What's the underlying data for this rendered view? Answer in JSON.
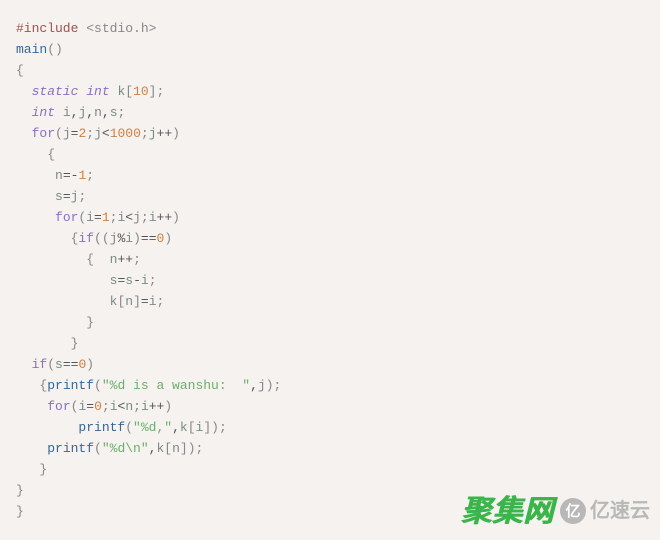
{
  "code": {
    "lines": [
      [
        {
          "t": "#include ",
          "c": "c-preproc"
        },
        {
          "t": "<",
          "c": "c-include-path"
        },
        {
          "t": "stdio",
          "c": "c-include-path"
        },
        {
          "t": ".",
          "c": "c-include-path"
        },
        {
          "t": "h",
          "c": "c-include-path"
        },
        {
          "t": ">",
          "c": "c-include-path"
        }
      ],
      [
        {
          "t": "main",
          "c": "c-builtin"
        },
        {
          "t": "(",
          "c": "c-paren"
        },
        {
          "t": ")",
          "c": "c-paren"
        }
      ],
      [
        {
          "t": "{",
          "c": "c-brace"
        }
      ],
      [
        {
          "t": "  ",
          "c": ""
        },
        {
          "t": "static int",
          "c": "c-keyword"
        },
        {
          "t": " ",
          "c": ""
        },
        {
          "t": "k",
          "c": "c-ident"
        },
        {
          "t": "[",
          "c": "c-bracket"
        },
        {
          "t": "10",
          "c": "c-num"
        },
        {
          "t": "]",
          "c": "c-bracket"
        },
        {
          "t": ";",
          "c": "c-semi"
        }
      ],
      [
        {
          "t": "  ",
          "c": ""
        },
        {
          "t": "int",
          "c": "c-keyword"
        },
        {
          "t": " ",
          "c": ""
        },
        {
          "t": "i",
          "c": "c-ident"
        },
        {
          "t": ",",
          "c": "c-op"
        },
        {
          "t": "j",
          "c": "c-ident"
        },
        {
          "t": ",",
          "c": "c-op"
        },
        {
          "t": "n",
          "c": "c-ident"
        },
        {
          "t": ",",
          "c": "c-op"
        },
        {
          "t": "s",
          "c": "c-ident"
        },
        {
          "t": ";",
          "c": "c-semi"
        }
      ],
      [
        {
          "t": "  ",
          "c": ""
        },
        {
          "t": "for",
          "c": "c-ctrl"
        },
        {
          "t": "(",
          "c": "c-paren"
        },
        {
          "t": "j",
          "c": "c-ident"
        },
        {
          "t": "=",
          "c": "c-op"
        },
        {
          "t": "2",
          "c": "c-num"
        },
        {
          "t": ";",
          "c": "c-semi"
        },
        {
          "t": "j",
          "c": "c-ident"
        },
        {
          "t": "<",
          "c": "c-op"
        },
        {
          "t": "1000",
          "c": "c-num"
        },
        {
          "t": ";",
          "c": "c-semi"
        },
        {
          "t": "j",
          "c": "c-ident"
        },
        {
          "t": "++",
          "c": "c-op"
        },
        {
          "t": ")",
          "c": "c-paren"
        }
      ],
      [
        {
          "t": "    ",
          "c": ""
        },
        {
          "t": "{",
          "c": "c-brace"
        }
      ],
      [
        {
          "t": "     ",
          "c": ""
        },
        {
          "t": "n",
          "c": "c-ident"
        },
        {
          "t": "=",
          "c": "c-op"
        },
        {
          "t": "-",
          "c": "c-op"
        },
        {
          "t": "1",
          "c": "c-num"
        },
        {
          "t": ";",
          "c": "c-semi"
        }
      ],
      [
        {
          "t": "     ",
          "c": ""
        },
        {
          "t": "s",
          "c": "c-ident"
        },
        {
          "t": "=",
          "c": "c-op"
        },
        {
          "t": "j",
          "c": "c-ident"
        },
        {
          "t": ";",
          "c": "c-semi"
        }
      ],
      [
        {
          "t": "     ",
          "c": ""
        },
        {
          "t": "for",
          "c": "c-ctrl"
        },
        {
          "t": "(",
          "c": "c-paren"
        },
        {
          "t": "i",
          "c": "c-ident"
        },
        {
          "t": "=",
          "c": "c-op"
        },
        {
          "t": "1",
          "c": "c-num"
        },
        {
          "t": ";",
          "c": "c-semi"
        },
        {
          "t": "i",
          "c": "c-ident"
        },
        {
          "t": "<",
          "c": "c-op"
        },
        {
          "t": "j",
          "c": "c-ident"
        },
        {
          "t": ";",
          "c": "c-semi"
        },
        {
          "t": "i",
          "c": "c-ident"
        },
        {
          "t": "++",
          "c": "c-op"
        },
        {
          "t": ")",
          "c": "c-paren"
        }
      ],
      [
        {
          "t": "       ",
          "c": ""
        },
        {
          "t": "{",
          "c": "c-brace"
        },
        {
          "t": "if",
          "c": "c-ctrl"
        },
        {
          "t": "(",
          "c": "c-paren"
        },
        {
          "t": "(",
          "c": "c-paren"
        },
        {
          "t": "j",
          "c": "c-ident"
        },
        {
          "t": "%",
          "c": "c-op"
        },
        {
          "t": "i",
          "c": "c-ident"
        },
        {
          "t": ")",
          "c": "c-paren"
        },
        {
          "t": "==",
          "c": "c-op"
        },
        {
          "t": "0",
          "c": "c-num"
        },
        {
          "t": ")",
          "c": "c-paren"
        }
      ],
      [
        {
          "t": "         ",
          "c": ""
        },
        {
          "t": "{",
          "c": "c-brace"
        },
        {
          "t": "  ",
          "c": ""
        },
        {
          "t": "n",
          "c": "c-ident"
        },
        {
          "t": "++",
          "c": "c-op"
        },
        {
          "t": ";",
          "c": "c-semi"
        }
      ],
      [
        {
          "t": "            ",
          "c": ""
        },
        {
          "t": "s",
          "c": "c-ident"
        },
        {
          "t": "=",
          "c": "c-op"
        },
        {
          "t": "s",
          "c": "c-ident"
        },
        {
          "t": "-",
          "c": "c-op"
        },
        {
          "t": "i",
          "c": "c-ident"
        },
        {
          "t": ";",
          "c": "c-semi"
        }
      ],
      [
        {
          "t": "            ",
          "c": ""
        },
        {
          "t": "k",
          "c": "c-ident"
        },
        {
          "t": "[",
          "c": "c-bracket"
        },
        {
          "t": "n",
          "c": "c-ident"
        },
        {
          "t": "]",
          "c": "c-bracket"
        },
        {
          "t": "=",
          "c": "c-op"
        },
        {
          "t": "i",
          "c": "c-ident"
        },
        {
          "t": ";",
          "c": "c-semi"
        }
      ],
      [
        {
          "t": "         ",
          "c": ""
        },
        {
          "t": "}",
          "c": "c-brace"
        }
      ],
      [
        {
          "t": "       ",
          "c": ""
        },
        {
          "t": "}",
          "c": "c-brace"
        }
      ],
      [
        {
          "t": "  ",
          "c": ""
        },
        {
          "t": "if",
          "c": "c-ctrl"
        },
        {
          "t": "(",
          "c": "c-paren"
        },
        {
          "t": "s",
          "c": "c-ident"
        },
        {
          "t": "==",
          "c": "c-op"
        },
        {
          "t": "0",
          "c": "c-num"
        },
        {
          "t": ")",
          "c": "c-paren"
        }
      ],
      [
        {
          "t": "   ",
          "c": ""
        },
        {
          "t": "{",
          "c": "c-brace"
        },
        {
          "t": "printf",
          "c": "c-builtin"
        },
        {
          "t": "(",
          "c": "c-paren"
        },
        {
          "t": "\"%d is a wanshu:  \"",
          "c": "c-str"
        },
        {
          "t": ",",
          "c": "c-op"
        },
        {
          "t": "j",
          "c": "c-ident"
        },
        {
          "t": ")",
          "c": "c-paren"
        },
        {
          "t": ";",
          "c": "c-semi"
        }
      ],
      [
        {
          "t": "    ",
          "c": ""
        },
        {
          "t": "for",
          "c": "c-ctrl"
        },
        {
          "t": "(",
          "c": "c-paren"
        },
        {
          "t": "i",
          "c": "c-ident"
        },
        {
          "t": "=",
          "c": "c-op"
        },
        {
          "t": "0",
          "c": "c-num"
        },
        {
          "t": ";",
          "c": "c-semi"
        },
        {
          "t": "i",
          "c": "c-ident"
        },
        {
          "t": "<",
          "c": "c-op"
        },
        {
          "t": "n",
          "c": "c-ident"
        },
        {
          "t": ";",
          "c": "c-semi"
        },
        {
          "t": "i",
          "c": "c-ident"
        },
        {
          "t": "++",
          "c": "c-op"
        },
        {
          "t": ")",
          "c": "c-paren"
        }
      ],
      [
        {
          "t": "        ",
          "c": ""
        },
        {
          "t": "printf",
          "c": "c-builtin"
        },
        {
          "t": "(",
          "c": "c-paren"
        },
        {
          "t": "\"%d,\"",
          "c": "c-str"
        },
        {
          "t": ",",
          "c": "c-op"
        },
        {
          "t": "k",
          "c": "c-ident"
        },
        {
          "t": "[",
          "c": "c-bracket"
        },
        {
          "t": "i",
          "c": "c-ident"
        },
        {
          "t": "]",
          "c": "c-bracket"
        },
        {
          "t": ")",
          "c": "c-paren"
        },
        {
          "t": ";",
          "c": "c-semi"
        }
      ],
      [
        {
          "t": "    ",
          "c": ""
        },
        {
          "t": "printf",
          "c": "c-builtin"
        },
        {
          "t": "(",
          "c": "c-paren"
        },
        {
          "t": "\"%d\\n\"",
          "c": "c-str"
        },
        {
          "t": ",",
          "c": "c-op"
        },
        {
          "t": "k",
          "c": "c-ident"
        },
        {
          "t": "[",
          "c": "c-bracket"
        },
        {
          "t": "n",
          "c": "c-ident"
        },
        {
          "t": "]",
          "c": "c-bracket"
        },
        {
          "t": ")",
          "c": "c-paren"
        },
        {
          "t": ";",
          "c": "c-semi"
        }
      ],
      [
        {
          "t": "   ",
          "c": ""
        },
        {
          "t": "}",
          "c": "c-brace"
        }
      ],
      [
        {
          "t": "}",
          "c": "c-brace"
        }
      ],
      [
        {
          "t": "}",
          "c": "c-brace"
        }
      ]
    ]
  },
  "watermark": {
    "juji": "聚集网",
    "yisu_badge": "亿",
    "yisu_text": "亿速云"
  }
}
